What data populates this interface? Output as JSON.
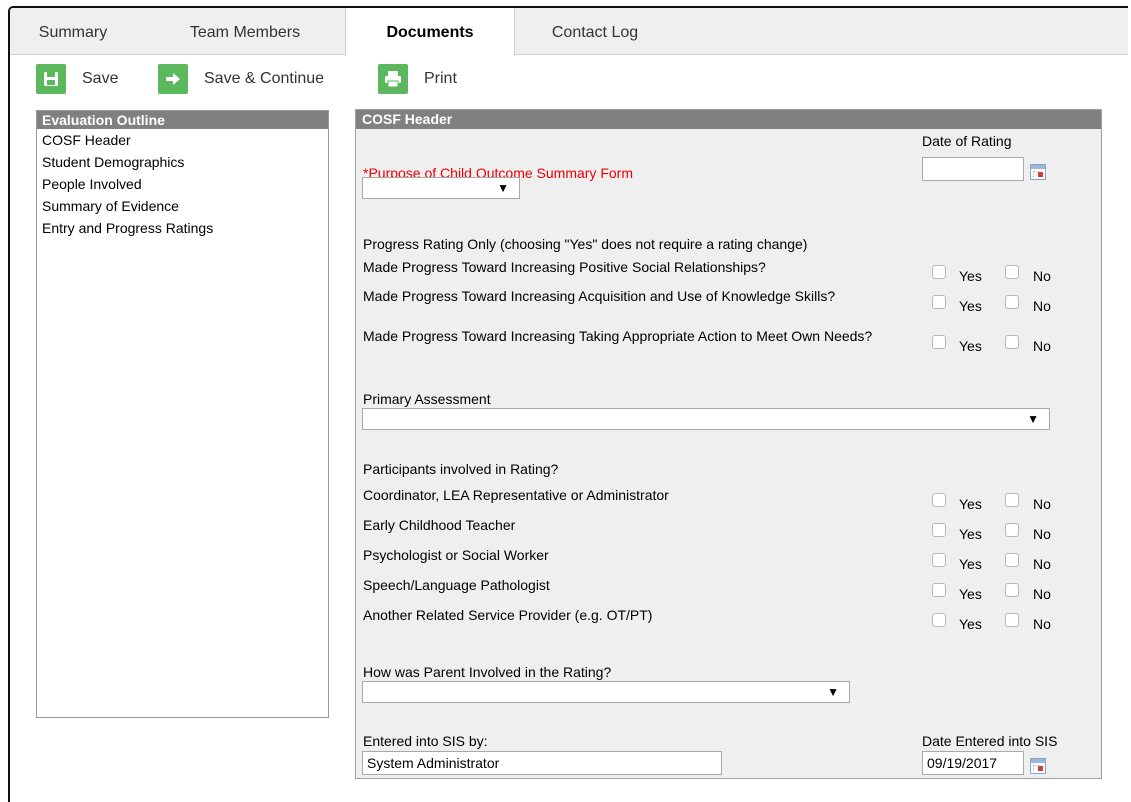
{
  "tabs": [
    "Summary",
    "Team Members",
    "Documents",
    "Contact Log"
  ],
  "toolbar": {
    "save": "Save",
    "save_continue": "Save & Continue",
    "print": "Print"
  },
  "outline": {
    "title": "Evaluation Outline",
    "items": [
      "COSF Header",
      "Student Demographics",
      "People Involved",
      "Summary of Evidence",
      "Entry and Progress Ratings"
    ]
  },
  "form": {
    "title": "COSF Header",
    "date_of_rating_label": "Date of Rating",
    "date_of_rating_value": "",
    "purpose_label": "*Purpose of Child Outcome Summary Form",
    "purpose_value": "",
    "progress_heading": "Progress Rating Only (choosing \"Yes\" does not require a rating change)",
    "progress_questions": [
      "Made Progress Toward Increasing Positive Social Relationships?",
      "Made Progress Toward Increasing Acquisition and Use of Knowledge Skills?",
      "Made Progress Toward Increasing Taking Appropriate Action to Meet Own Needs?"
    ],
    "yes_label": "Yes",
    "no_label": "No",
    "primary_assessment_label": "Primary Assessment",
    "primary_assessment_value": "",
    "participants_heading": "Participants involved in Rating?",
    "participants": [
      "Coordinator, LEA Representative or Administrator",
      "Early Childhood Teacher",
      "Psychologist or Social Worker",
      "Speech/Language Pathologist",
      "Another Related Service Provider (e.g. OT/PT)"
    ],
    "parent_label": "How was Parent Involved in the Rating?",
    "parent_value": "",
    "entered_by_label": "Entered into SIS by:",
    "entered_by_value": "System Administrator",
    "date_entered_label": "Date Entered into SIS",
    "date_entered_value": "09/19/2017"
  },
  "colors": {
    "header_bar": "#808080",
    "panel_bg": "#efefef",
    "toolbar_green": "#5cb85c",
    "required_red": "#ee0000"
  },
  "icons": {
    "save": "floppy-disk-icon",
    "save_continue": "arrow-right-icon",
    "print": "printer-icon",
    "calendar": "calendar-icon"
  }
}
